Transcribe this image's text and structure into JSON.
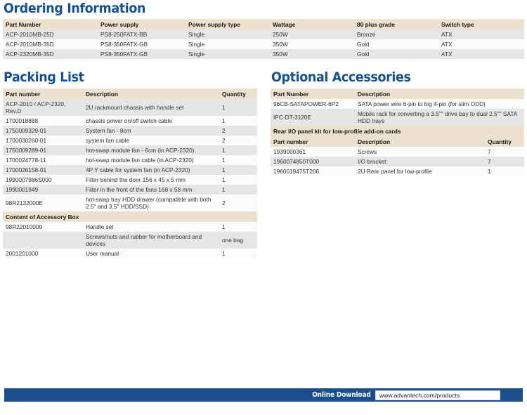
{
  "ordering": {
    "title": "Ordering Information",
    "columns": [
      "Part Number",
      "Power supply",
      "Power supply type",
      "Wattage",
      "80 plus grade",
      "Switch type"
    ],
    "rows": [
      [
        "ACP-2010MB-25D",
        "PS8-250FATX-BB",
        "Single",
        "250W",
        "Bronze",
        "ATX"
      ],
      [
        "ACP-2010MB-35D",
        "PS8-350FATX-GB",
        "Single",
        "350W",
        "Gold",
        "ATX"
      ],
      [
        "ACP-2320MB-35D",
        "PS8-350FATX-GB",
        "Single",
        "350W",
        "Gold",
        "ATX"
      ]
    ]
  },
  "packing": {
    "title": "Packing List",
    "columns": [
      "Part number",
      "Description",
      "Quantity"
    ],
    "rows": [
      [
        "ACP-2010 / ACP-2320, Rev.D",
        "2U rackmount chassis with handle set",
        "1"
      ],
      [
        "1700018888",
        "chassis power on/off switch cable",
        "1"
      ],
      [
        "1750009329-01",
        "System fan - 8cm",
        "2"
      ],
      [
        "1700030260-01",
        "system fan cable",
        "2"
      ],
      [
        "1750009289-01",
        "hot-swap module fan - 6cm (in ACP-2320)",
        "1"
      ],
      [
        "1700024778-11",
        "hot-swap module fan cable (in ACP-2320)",
        "1"
      ],
      [
        "1700026158-01",
        "4P Y cable for system fan (in ACP-2320)",
        "1"
      ],
      [
        "1990007986S000",
        "Filter behind the door 156 x 45 x 5 mm",
        "1"
      ],
      [
        "1990001949",
        "Filter in the front of the fans 168 x 58 mm",
        "1"
      ],
      [
        "98R2132000E",
        "hot-swap tray HDD drawer (compatible with both 2.5\" and 3.5\" HDD/SSD)",
        "2"
      ]
    ],
    "accessory_box_header": "Content of Accessory Box",
    "accessory_rows": [
      [
        "98R22010000",
        "Handle set",
        "1"
      ],
      [
        "",
        "Screws/nuts and rubber for motherboard and devices",
        "one bag"
      ],
      [
        "2001201000",
        "User manual",
        "1"
      ]
    ]
  },
  "optional": {
    "title": "Optional Accessories",
    "columns": [
      "Part Number",
      "Description"
    ],
    "rows": [
      [
        "96CB-SATAPOWER-6P2",
        "SATA power wire 6-pin to big 4-pin (for slim ODD)"
      ],
      [
        "IPC-DT-3120E",
        "Mobile rack for converting a 3.5\"\" drive bay to dual 2.5\"\" SATA HDD trays"
      ]
    ],
    "rear_io_header": "Rear I/O panel kit for low-profile add-on cards",
    "rear_io_columns": [
      "Part number",
      "Description",
      "Quantity"
    ],
    "rear_io_rows": [
      [
        "1939000361",
        "Screws",
        "7"
      ],
      [
        "1960074850T000",
        "I/O bracket",
        "7"
      ],
      [
        "1960019475T206",
        "2U Rear panel for low-profile",
        "1"
      ]
    ]
  },
  "footer": {
    "online_download_label": "Online Download",
    "url": "www.advantech.com/products"
  },
  "colors": {
    "heading_blue": "#14538f",
    "table_header_beige": "#ece0cf",
    "row_gray": "#e6e6e6",
    "row_light": "#f4f4f4",
    "footer_blue": "#1b4d8a"
  }
}
